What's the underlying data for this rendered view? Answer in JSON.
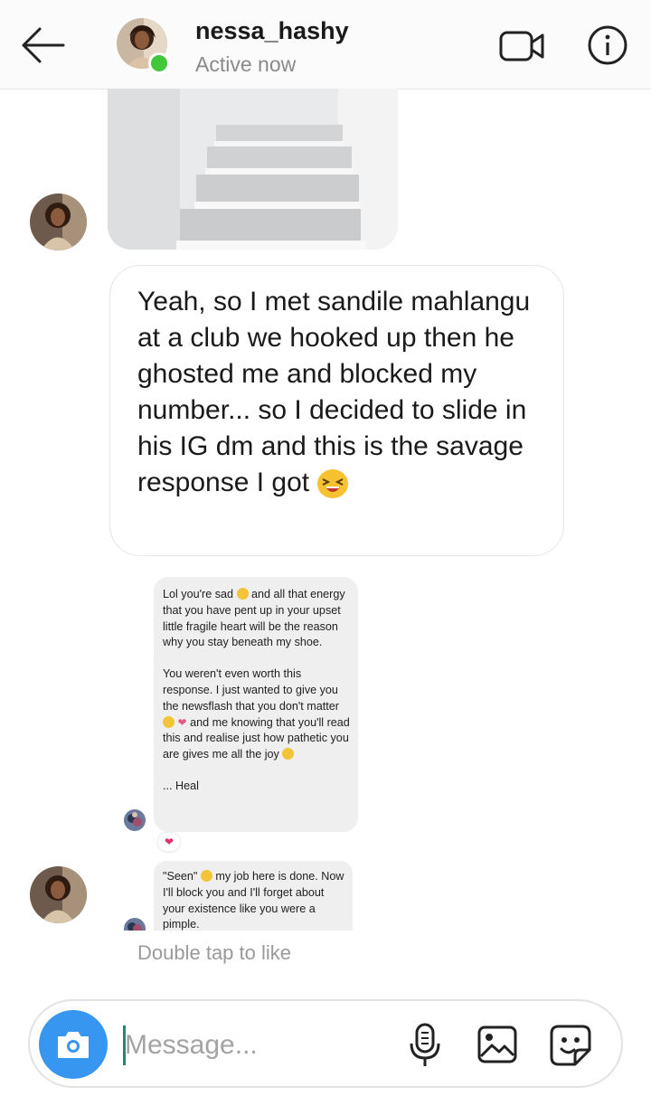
{
  "header": {
    "username": "nessa_hashy",
    "status": "Active now",
    "back_icon": "arrow-left-icon",
    "video_icon": "video-camera-icon",
    "info_icon": "info-icon"
  },
  "messages": {
    "main_text": "Yeah, so I met sandile mahlangu at a club we hooked up then he ghosted me and blocked my number... so I decided to slide in his IG dm and this is the savage response I got",
    "main_emoji": "grinning-squint-emoji",
    "screenshot_1": {
      "p1a": "Lol you're sad",
      "p1b": "and all that energy that you have pent up in your upset little fragile heart will be the reason why you stay beneath my shoe.",
      "p2a": "You weren't even worth this response. I just wanted to give you the newsflash that you don't matter",
      "p2b": "and me knowing that you'll read this and realise just how pathetic you are gives me all the joy",
      "p3": "... Heal"
    },
    "screenshot_2": {
      "p1a": "\"Seen\"",
      "p1b": "my job here is done. Now I'll block you and I'll forget about your existence like you were a pimple."
    },
    "heart_reaction": "❤"
  },
  "hint": {
    "double_tap": "Double tap to like"
  },
  "composer": {
    "placeholder": "Message...",
    "camera_icon": "camera-icon",
    "mic_icon": "microphone-icon",
    "gallery_icon": "gallery-icon",
    "sticker_icon": "sticker-icon"
  },
  "colors": {
    "accent_blue": "#3797f0",
    "online_green": "#41c83a"
  }
}
